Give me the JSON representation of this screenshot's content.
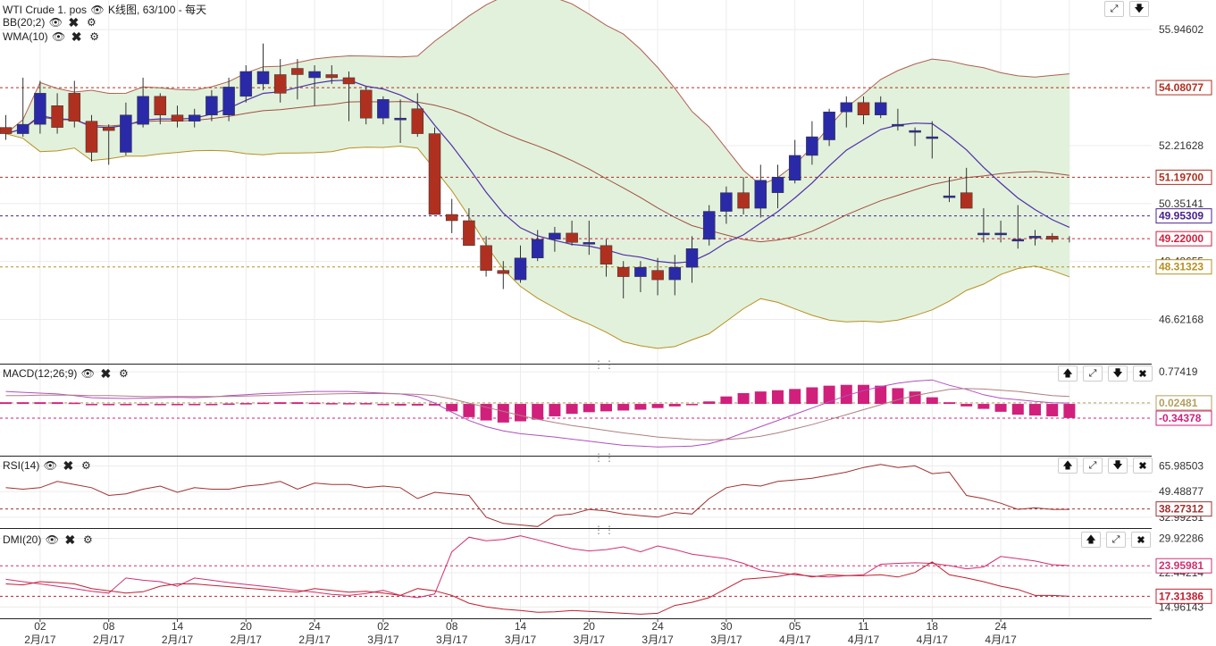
{
  "header": {
    "main_title": "WTI Crude 1. pos",
    "main_type": "K线图, 63/100 - 每天",
    "bb_label": "BB(20;2)",
    "wma_label": "WMA(10)",
    "macd_label": "MACD(12;26;9)",
    "rsi_label": "RSI(14)",
    "dmi_label": "DMI(20)"
  },
  "colors": {
    "up": "#2a2aa8",
    "down": "#b03020",
    "bb_fill": "#e2f1dc",
    "bb_upper": "#b06050",
    "bb_lower": "#b89020",
    "bb_mid": "#a05040",
    "wma": "#5030a8",
    "macd_hist": "#d0207c",
    "rsi": "#a03030",
    "dmi_plus": "#d03070",
    "dmi_minus": "#c02030"
  },
  "chart_data": [
    {
      "type": "candlestick",
      "name": "WTI Crude 1. pos",
      "ylim": [
        45.2,
        56.9
      ],
      "yticks": [
        "55.94602",
        "52.21628",
        "50.35141",
        "48.48655",
        "46.62168"
      ],
      "ytick_values": [
        55.946,
        52.216,
        50.351,
        48.487,
        46.622
      ],
      "price_labels": [
        {
          "text": "54.08077",
          "value": 54.081,
          "color": "#b03020"
        },
        {
          "text": "51.19700",
          "value": 51.197,
          "color": "#b03020"
        },
        {
          "text": "49.95309",
          "value": 49.953,
          "color": "#4a2090"
        },
        {
          "text": "49.22000",
          "value": 49.22,
          "color": "#d02040"
        },
        {
          "text": "48.31323",
          "value": 48.313,
          "color": "#b89020"
        }
      ],
      "x": [
        "01/31",
        "02/01",
        "02/02",
        "02/03",
        "02/06",
        "02/07",
        "02/08",
        "02/09",
        "02/10",
        "02/13",
        "02/14",
        "02/15",
        "02/16",
        "02/17",
        "02/21",
        "02/22",
        "02/23",
        "02/24",
        "02/27",
        "02/28",
        "03/01",
        "03/02",
        "03/03",
        "03/06",
        "03/07",
        "03/08",
        "03/09",
        "03/10",
        "03/13",
        "03/14",
        "03/15",
        "03/16",
        "03/17",
        "03/20",
        "03/21",
        "03/22",
        "03/23",
        "03/24",
        "03/27",
        "03/28",
        "03/29",
        "03/30",
        "03/31",
        "04/03",
        "04/04",
        "04/05",
        "04/06",
        "04/07",
        "04/10",
        "04/11",
        "04/12",
        "04/13",
        "04/17",
        "04/18",
        "04/19",
        "04/20",
        "04/21",
        "04/24",
        "04/25",
        "04/26",
        "04/27",
        "04/28",
        "05/01"
      ],
      "open": [
        52.8,
        52.6,
        52.9,
        53.5,
        53.9,
        53.0,
        52.8,
        52.0,
        52.9,
        53.8,
        53.2,
        53.0,
        53.2,
        53.2,
        53.8,
        54.2,
        54.5,
        54.7,
        54.4,
        54.5,
        54.4,
        54.0,
        53.1,
        53.1,
        53.4,
        52.6,
        50.0,
        49.8,
        49.0,
        48.2,
        47.9,
        48.6,
        49.2,
        49.4,
        49.1,
        49.0,
        48.3,
        48.0,
        48.2,
        47.9,
        48.3,
        49.2,
        50.1,
        50.7,
        50.2,
        50.7,
        51.1,
        51.9,
        52.4,
        53.3,
        53.6,
        53.2,
        52.9,
        52.7,
        52.5,
        50.6,
        50.7,
        49.4,
        49.4,
        49.2,
        49.3,
        49.3
      ],
      "close": [
        52.6,
        52.9,
        53.9,
        52.8,
        53.0,
        52.0,
        52.7,
        53.2,
        53.8,
        53.2,
        53.0,
        53.2,
        53.8,
        54.1,
        54.6,
        54.6,
        53.9,
        54.5,
        54.6,
        54.4,
        54.2,
        53.1,
        53.7,
        53.1,
        52.6,
        50.0,
        49.8,
        49.0,
        48.2,
        48.1,
        48.6,
        49.2,
        49.4,
        49.1,
        49.1,
        48.4,
        48.0,
        48.3,
        47.9,
        48.3,
        48.9,
        50.1,
        50.7,
        50.2,
        51.1,
        51.2,
        51.9,
        52.5,
        53.3,
        53.6,
        53.2,
        53.6,
        52.9,
        52.7,
        52.5,
        50.6,
        50.2,
        49.4,
        49.4,
        49.2,
        49.3,
        49.2,
        49.2
      ],
      "high": [
        53.2,
        54.4,
        54.3,
        53.9,
        54.3,
        53.2,
        52.9,
        53.6,
        54.4,
        53.9,
        53.5,
        53.4,
        54.0,
        54.4,
        54.8,
        55.5,
        55.0,
        55.0,
        54.8,
        54.8,
        54.6,
        54.1,
        53.8,
        53.7,
        53.9,
        52.8,
        50.5,
        50.2,
        49.3,
        48.5,
        49.0,
        49.5,
        49.6,
        49.8,
        49.8,
        49.2,
        48.5,
        48.5,
        48.6,
        48.7,
        49.3,
        50.3,
        50.9,
        51.2,
        51.6,
        51.6,
        52.4,
        53.0,
        53.4,
        53.8,
        53.8,
        53.8,
        53.4,
        52.8,
        53.0,
        51.2,
        51.5,
        50.2,
        49.8,
        50.3,
        49.5,
        49.4,
        49.3
      ],
      "low": [
        52.4,
        52.5,
        52.6,
        52.6,
        52.8,
        51.7,
        51.6,
        51.9,
        52.8,
        52.9,
        52.8,
        52.8,
        53.0,
        53.0,
        53.6,
        54.0,
        53.6,
        53.7,
        53.5,
        54.2,
        53.0,
        52.9,
        52.9,
        52.3,
        52.5,
        50.0,
        49.4,
        49.0,
        48.0,
        47.6,
        47.8,
        48.5,
        48.8,
        49.0,
        48.7,
        48.0,
        47.3,
        47.5,
        47.4,
        47.4,
        47.8,
        49.0,
        49.7,
        50.0,
        49.9,
        50.2,
        51.0,
        51.6,
        52.2,
        52.8,
        52.9,
        53.1,
        52.7,
        52.2,
        51.8,
        50.4,
        50.4,
        49.1,
        49.1,
        48.9,
        49.0,
        49.1,
        49.1
      ]
    },
    {
      "type": "line",
      "name": "MACD(12;26;9)",
      "ylim": [
        -1.25,
        0.95
      ],
      "yticks": [
        "0.77419"
      ],
      "ytick_values": [
        0.774
      ],
      "value_labels": [
        {
          "text": "0.02481",
          "value": 0.025,
          "color": "#b0a060"
        },
        {
          "text": "-0.34378",
          "value": -0.344,
          "color": "#d0207c"
        }
      ],
      "macd": [
        0.3,
        0.28,
        0.26,
        0.24,
        0.2,
        0.15,
        0.14,
        0.13,
        0.14,
        0.15,
        0.16,
        0.15,
        0.17,
        0.2,
        0.22,
        0.25,
        0.26,
        0.28,
        0.3,
        0.3,
        0.3,
        0.28,
        0.26,
        0.24,
        0.18,
        0.02,
        -0.2,
        -0.4,
        -0.55,
        -0.65,
        -0.72,
        -0.76,
        -0.8,
        -0.85,
        -0.9,
        -0.95,
        -1.0,
        -1.02,
        -1.04,
        -1.03,
        -1.02,
        -0.96,
        -0.85,
        -0.7,
        -0.55,
        -0.4,
        -0.25,
        -0.1,
        0.05,
        0.2,
        0.32,
        0.42,
        0.5,
        0.55,
        0.58,
        0.45,
        0.35,
        0.22,
        0.14,
        0.1,
        0.06,
        0.03,
        0.02
      ],
      "signal": [
        0.2,
        0.2,
        0.21,
        0.21,
        0.21,
        0.2,
        0.2,
        0.19,
        0.18,
        0.18,
        0.18,
        0.18,
        0.18,
        0.18,
        0.19,
        0.2,
        0.21,
        0.22,
        0.23,
        0.24,
        0.25,
        0.25,
        0.25,
        0.24,
        0.23,
        0.2,
        0.12,
        0.02,
        -0.08,
        -0.18,
        -0.28,
        -0.37,
        -0.45,
        -0.52,
        -0.58,
        -0.64,
        -0.7,
        -0.75,
        -0.8,
        -0.83,
        -0.86,
        -0.87,
        -0.86,
        -0.83,
        -0.78,
        -0.7,
        -0.6,
        -0.5,
        -0.38,
        -0.26,
        -0.14,
        -0.02,
        0.1,
        0.2,
        0.28,
        0.35,
        0.37,
        0.36,
        0.33,
        0.3,
        0.25,
        0.2,
        0.18
      ],
      "histogram": [
        0.04,
        0.04,
        0.04,
        0.04,
        0.03,
        -0.02,
        -0.02,
        -0.03,
        -0.03,
        0.0,
        -0.02,
        -0.02,
        0.0,
        0.01,
        0.02,
        0.03,
        0.04,
        0.04,
        0.03,
        0.02,
        0.02,
        0.02,
        0.0,
        -0.04,
        -0.04,
        -0.04,
        -0.18,
        -0.32,
        -0.4,
        -0.45,
        -0.42,
        -0.38,
        -0.3,
        -0.24,
        -0.2,
        -0.18,
        -0.16,
        -0.14,
        -0.1,
        -0.06,
        -0.02,
        0.06,
        0.18,
        0.26,
        0.3,
        0.33,
        0.36,
        0.4,
        0.44,
        0.46,
        0.46,
        0.44,
        0.38,
        0.3,
        0.16,
        0.04,
        -0.06,
        -0.12,
        -0.19,
        -0.26,
        -0.28,
        -0.3,
        -0.34
      ]
    },
    {
      "type": "line",
      "name": "RSI(14)",
      "ylim": [
        26,
        72
      ],
      "yticks": [
        "65.98503",
        "49.48877",
        "32.99251"
      ],
      "ytick_values": [
        65.985,
        49.489,
        32.993
      ],
      "value_labels": [
        {
          "text": "38.27312",
          "value": 38.273,
          "color": "#a03030"
        }
      ],
      "values": [
        52,
        51,
        52,
        56,
        54,
        52,
        47,
        48,
        51,
        53,
        49,
        52,
        51,
        51,
        53,
        54,
        56,
        51,
        55,
        54,
        54,
        52,
        53,
        52,
        45,
        49,
        48,
        47,
        33,
        29,
        28,
        27,
        34,
        35,
        38,
        37,
        35,
        34,
        33,
        36,
        35,
        45,
        52,
        54,
        53,
        56,
        57,
        58,
        60,
        62,
        65,
        67,
        65,
        66,
        61,
        62,
        47,
        45,
        42,
        38,
        39,
        38,
        38
      ],
      "reference_level": 38.27
    },
    {
      "type": "line",
      "name": "DMI(20)",
      "ylim": [
        12.5,
        32.0
      ],
      "yticks": [
        "29.92286",
        "22.44214",
        "14.96143"
      ],
      "ytick_values": [
        29.923,
        22.442,
        14.961
      ],
      "value_labels": [
        {
          "text": "23.95981",
          "value": 23.96,
          "color": "#d03070"
        },
        {
          "text": "17.31386",
          "value": 17.314,
          "color": "#c02030"
        }
      ],
      "plus_di": [
        21.0,
        20.5,
        20.0,
        19.5,
        19.0,
        18.4,
        18.0,
        21.3,
        20.8,
        20.5,
        19.5,
        21.3,
        20.8,
        20.3,
        19.9,
        19.5,
        19.1,
        18.6,
        18.2,
        17.7,
        17.5,
        17.9,
        18.6,
        17.5,
        17.0,
        17.8,
        27.0,
        30.2,
        29.4,
        29.7,
        30.5,
        29.6,
        28.6,
        27.7,
        27.2,
        27.5,
        28.1,
        27.0,
        28.3,
        27.5,
        26.5,
        26.0,
        25.5,
        24.5,
        23.0,
        22.5,
        22.0,
        21.7,
        21.5,
        21.8,
        22.0,
        24.3,
        24.5,
        24.6,
        24.5,
        24.0,
        23.3,
        23.7,
        26.0,
        25.5,
        25.0,
        24.2,
        24.0
      ],
      "minus_di": [
        20.0,
        19.8,
        20.5,
        20.3,
        20.0,
        19.0,
        18.5,
        18.0,
        18.3,
        19.5,
        20.0,
        20.0,
        19.7,
        19.4,
        19.1,
        18.8,
        18.5,
        18.2,
        19.0,
        18.6,
        18.2,
        18.4,
        18.0,
        17.5,
        19.0,
        18.5,
        17.5,
        15.8,
        15.0,
        14.5,
        14.2,
        13.8,
        13.9,
        14.2,
        14.0,
        13.8,
        13.6,
        13.4,
        13.6,
        15.3,
        16.0,
        17.0,
        19.0,
        21.0,
        21.3,
        21.6,
        22.3,
        21.5,
        22.0,
        21.8,
        21.8,
        22.0,
        21.5,
        22.5,
        24.8,
        22.0,
        21.3,
        20.5,
        19.5,
        18.8,
        17.5,
        17.5,
        17.3
      ]
    }
  ],
  "x_axis": {
    "ticks": [
      {
        "day": "02",
        "month": "2月/17",
        "index": 2
      },
      {
        "day": "08",
        "month": "2月/17",
        "index": 6
      },
      {
        "day": "14",
        "month": "2月/17",
        "index": 10
      },
      {
        "day": "20",
        "month": "2月/17",
        "index": 14
      },
      {
        "day": "24",
        "month": "2月/17",
        "index": 18
      },
      {
        "day": "02",
        "month": "3月/17",
        "index": 22
      },
      {
        "day": "08",
        "month": "3月/17",
        "index": 26
      },
      {
        "day": "14",
        "month": "3月/17",
        "index": 30
      },
      {
        "day": "20",
        "month": "3月/17",
        "index": 34
      },
      {
        "day": "24",
        "month": "3月/17",
        "index": 38
      },
      {
        "day": "30",
        "month": "3月/17",
        "index": 42
      },
      {
        "day": "05",
        "month": "4月/17",
        "index": 46
      },
      {
        "day": "11",
        "month": "4月/17",
        "index": 50
      },
      {
        "day": "18",
        "month": "4月/17",
        "index": 54
      },
      {
        "day": "24",
        "month": "4月/17",
        "index": 58
      }
    ]
  },
  "icons": [
    "eye-icon",
    "close-icon",
    "gear-icon",
    "arrow-up-icon",
    "expand-icon",
    "arrow-down-icon",
    "drag-handle-icon"
  ]
}
